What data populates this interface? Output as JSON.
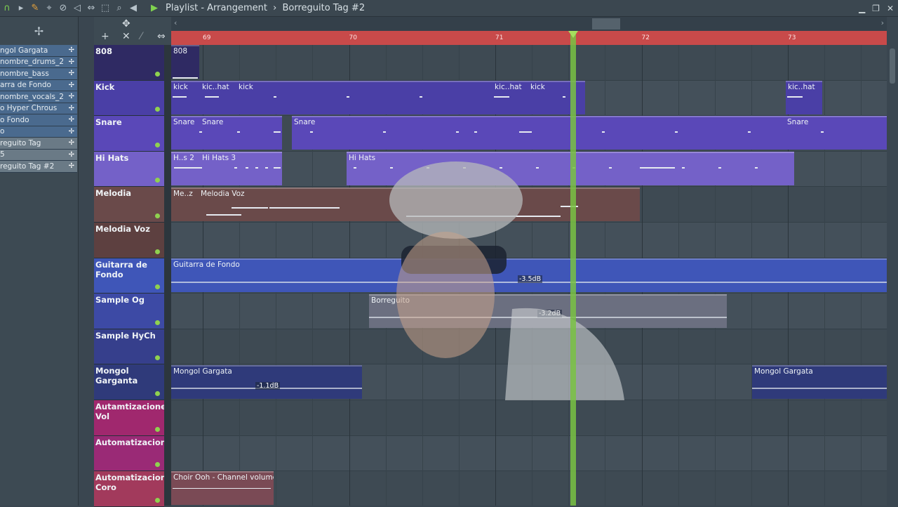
{
  "titlebar": {
    "title": "Playlist - Arrangement",
    "breadcrumb_sep": "›",
    "pattern": "Borreguito Tag #2"
  },
  "browser": {
    "items": [
      {
        "label": "ngol Gargata"
      },
      {
        "label": "nombre_drums_2"
      },
      {
        "label": "nombre_bass"
      },
      {
        "label": "arra de Fondo"
      },
      {
        "label": "nombre_vocals_2"
      },
      {
        "label": "o Hyper Chrous"
      },
      {
        "label": "o Fondo"
      },
      {
        "label": "o"
      },
      {
        "label": "reguito Tag"
      },
      {
        "label": "5"
      },
      {
        "label": "reguito Tag #2"
      }
    ]
  },
  "ruler": {
    "bars": [
      "69",
      "70",
      "71",
      "72",
      "73"
    ]
  },
  "tracks": [
    {
      "name": "808",
      "color": "#2f2a63"
    },
    {
      "name": "Kick",
      "color": "#4a3fa6"
    },
    {
      "name": "Snare",
      "color": "#5a48b8"
    },
    {
      "name": "Hi Hats",
      "color": "#7461c8"
    },
    {
      "name": "Melodia",
      "color": "#6a4a4a"
    },
    {
      "name": "Melodia Voz",
      "color": "#5d4040"
    },
    {
      "name": "Guitarra de Fondo",
      "color": "#3f56b8"
    },
    {
      "name": "Sample Og",
      "color": "#3d4aa5"
    },
    {
      "name": "Sample HyCh",
      "color": "#363f8c"
    },
    {
      "name": "Mongol Garganta",
      "color": "#2f3a7a"
    },
    {
      "name": "Autamtizaciones Vol",
      "color": "#a0286e"
    },
    {
      "name": "Automatizaciones",
      "color": "#9a2a76"
    },
    {
      "name": "Automatizaciones Coro",
      "color": "#a23a5c"
    }
  ],
  "clips": {
    "c808": "808",
    "kick1": "kick",
    "kick2": "kic..hat",
    "kick3": "kick",
    "kick4": "kic..hat",
    "kick5": "kick",
    "kick6": "kic..hat",
    "snare1": "Snare",
    "snare2": "Snare",
    "snare3": "Snare",
    "snare4": "Snare",
    "hh1": "H..s 2",
    "hh2": "Hi Hats 3",
    "hh3": "Hi Hats",
    "mel1": "Me..z",
    "mel2": "Melodia Voz",
    "guit": "Guitarra de Fondo",
    "guit_gain": "-3.5dB",
    "borreguito": "Borreguito",
    "borreguito_gain": "-3.2dB",
    "mongol1": "Mongol Gargata",
    "mongol1_gain": "-1.1dB",
    "mongol2": "Mongol Gargata",
    "choir": "Choir Ooh - Channel volume"
  },
  "icons": {
    "snap": "magnet-icon",
    "pencil": "pencil-icon",
    "play": "play-icon"
  }
}
